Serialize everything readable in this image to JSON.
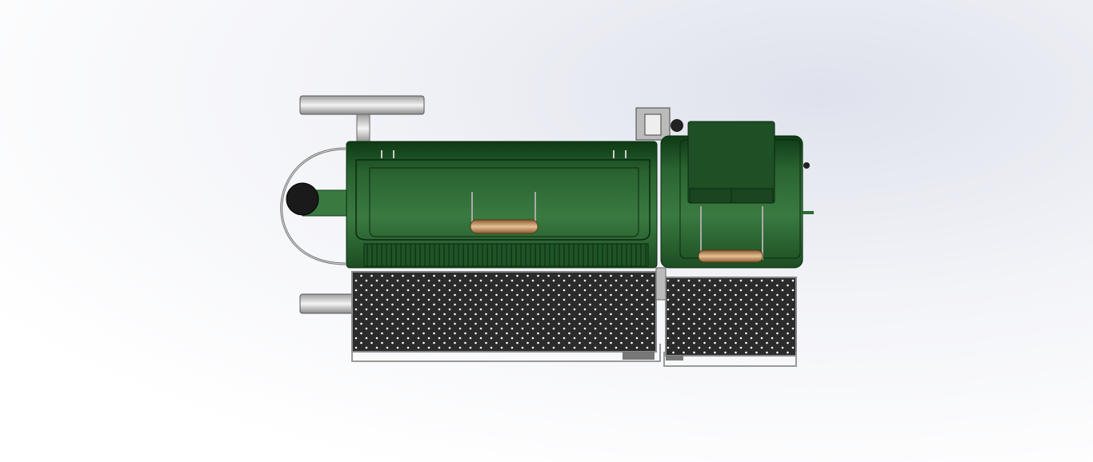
{
  "scene": {
    "subject": "",
    "colors": {
      "body_green": "#2f6b36",
      "dark_green": "#0f3d16",
      "tray": "#2b2b2b",
      "metal": "#c8c8c8",
      "wood": "#c89a6a",
      "background": "#eef0f5"
    }
  }
}
